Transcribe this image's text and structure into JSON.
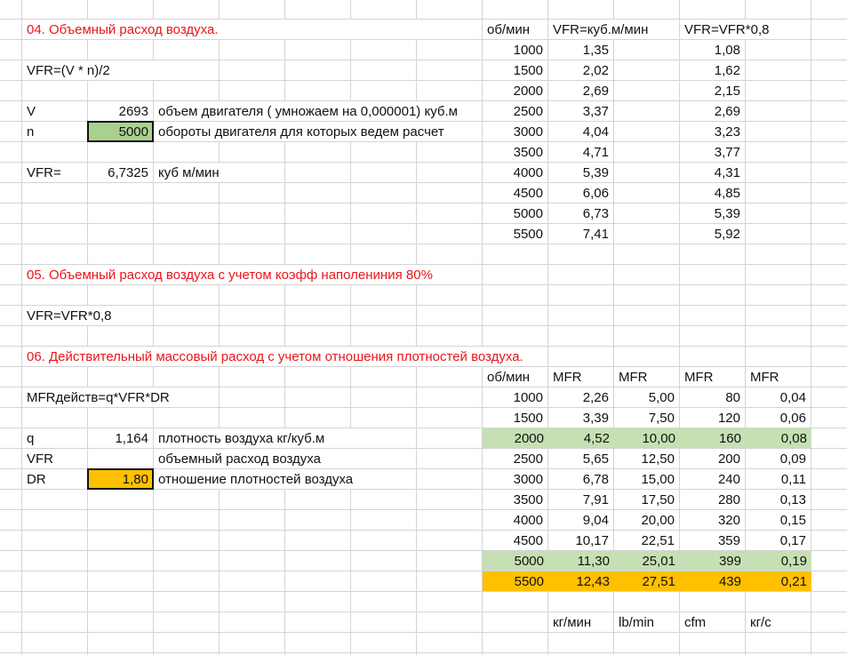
{
  "sheet": {
    "section04": {
      "title": "04. Объемный расход воздуха.",
      "formula": "VFR=(V * n)/2",
      "v_label": "V",
      "v_value": "2693",
      "v_note": "объем двигателя ( умножаем на 0,000001) куб.м",
      "n_label": "n",
      "n_value": "5000",
      "n_note": "обороты двигателя для которых ведем расчет",
      "vfr_label": "VFR=",
      "vfr_value": "6,7325",
      "vfr_unit": "куб м/мин"
    },
    "vfr_table": {
      "headers": [
        "об/мин",
        "VFR=куб.м/мин",
        "VFR=VFR*0,8"
      ],
      "rows": [
        [
          "1000",
          "1,35",
          "1,08"
        ],
        [
          "1500",
          "2,02",
          "1,62"
        ],
        [
          "2000",
          "2,69",
          "2,15"
        ],
        [
          "2500",
          "3,37",
          "2,69"
        ],
        [
          "3000",
          "4,04",
          "3,23"
        ],
        [
          "3500",
          "4,71",
          "3,77"
        ],
        [
          "4000",
          "5,39",
          "4,31"
        ],
        [
          "4500",
          "6,06",
          "4,85"
        ],
        [
          "5000",
          "6,73",
          "5,39"
        ],
        [
          "5500",
          "7,41",
          "5,92"
        ]
      ]
    },
    "section05": {
      "title": "05. Объемный расход воздуха с учетом коэфф наполениния 80%",
      "formula": "VFR=VFR*0,8"
    },
    "section06": {
      "title": "06. Действительный массовый расход с учетом отношения плотностей воздуха.",
      "formula": "MFRдейств=q*VFR*DR",
      "q_label": "q",
      "q_value": "1,164",
      "q_note": "плотность воздуха кг/куб.м",
      "vfr_label": "VFR",
      "vfr_note": "объемный расход воздуха",
      "dr_label": "DR",
      "dr_value": "1,80",
      "dr_note": "отношение плотностей воздуха"
    },
    "mfr_table": {
      "headers": [
        "об/мин",
        "MFR",
        "MFR",
        "MFR",
        "MFR"
      ],
      "rows": [
        [
          "1000",
          "2,26",
          "5,00",
          "80",
          "0,04"
        ],
        [
          "1500",
          "3,39",
          "7,50",
          "120",
          "0,06"
        ],
        [
          "2000",
          "4,52",
          "10,00",
          "160",
          "0,08"
        ],
        [
          "2500",
          "5,65",
          "12,50",
          "200",
          "0,09"
        ],
        [
          "3000",
          "6,78",
          "15,00",
          "240",
          "0,11"
        ],
        [
          "3500",
          "7,91",
          "17,50",
          "280",
          "0,13"
        ],
        [
          "4000",
          "9,04",
          "20,00",
          "320",
          "0,15"
        ],
        [
          "4500",
          "10,17",
          "22,51",
          "359",
          "0,17"
        ],
        [
          "5000",
          "11,30",
          "25,01",
          "399",
          "0,19"
        ],
        [
          "5500",
          "12,43",
          "27,51",
          "439",
          "0,21"
        ]
      ],
      "units": [
        "кг/мин",
        "lb/min",
        "cfm",
        "кг/с"
      ]
    },
    "colors": {
      "title_red": "#e8161b",
      "highlight_green": "#c6e0b4",
      "input_green": "#a9d08e",
      "highlight_orange": "#ffc000"
    }
  }
}
